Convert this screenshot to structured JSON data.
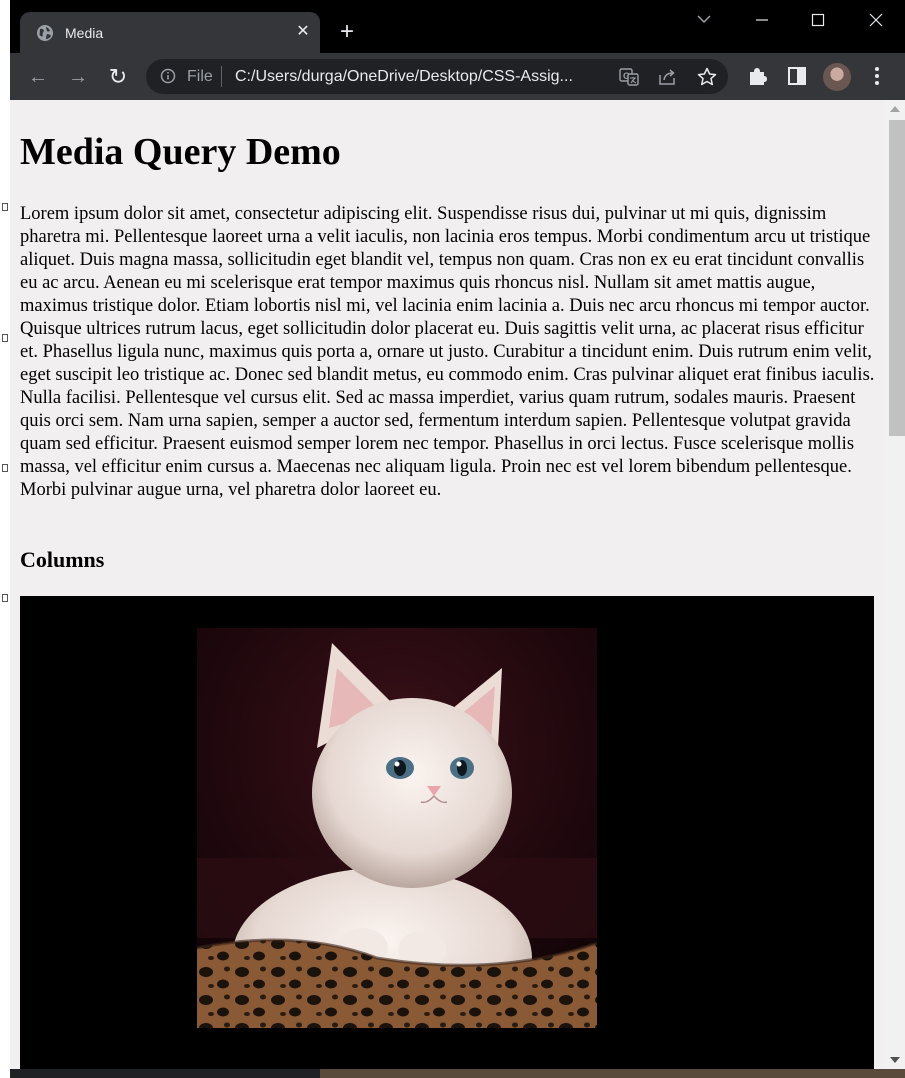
{
  "browser": {
    "tab": {
      "title": "Media",
      "close_glyph": "✕",
      "icon": "globe-icon"
    },
    "new_tab_glyph": "+",
    "window_controls": {
      "tab_search_glyph": "⌄",
      "minimize_glyph": "—",
      "maximize_glyph": "☐",
      "close_glyph": "✕"
    },
    "nav": {
      "back_glyph": "←",
      "forward_glyph": "→",
      "reload_glyph": "↻"
    },
    "omnibox": {
      "scheme": "File",
      "url": "C:/Users/durga/OneDrive/Desktop/CSS-Assig..."
    },
    "colors": {
      "frame": "#000000",
      "toolbar": "#35363a",
      "omnibox": "#202124",
      "page_background": "#f1efef"
    }
  },
  "page": {
    "heading": "Media Query Demo",
    "paragraph": "Lorem ipsum dolor sit amet, consectetur adipiscing elit. Suspendisse risus dui, pulvinar ut mi quis, dignissim pharetra mi. Pellentesque laoreet urna a velit iaculis, non lacinia eros tempus. Morbi condimentum arcu ut tristique aliquet. Duis magna massa, sollicitudin eget blandit vel, tempus non quam. Cras non ex eu erat tincidunt convallis eu ac arcu. Aenean eu mi scelerisque erat tempor maximus quis rhoncus nisl. Nullam sit amet mattis augue, maximus tristique dolor. Etiam lobortis nisl mi, vel lacinia enim lacinia a. Duis nec arcu rhoncus mi tempor auctor. Quisque ultrices rutrum lacus, eget sollicitudin dolor placerat eu. Duis sagittis velit urna, ac placerat risus efficitur et. Phasellus ligula nunc, maximus quis porta a, ornare ut justo. Curabitur a tincidunt enim. Duis rutrum enim velit, eget suscipit leo tristique ac. Donec sed blandit metus, eu commodo enim. Cras pulvinar aliquet erat finibus iaculis. Nulla facilisi. Pellentesque vel cursus elit. Sed ac massa imperdiet, varius quam rutrum, sodales mauris. Praesent quis orci sem. Nam urna sapien, semper a auctor sed, fermentum interdum sapien. Pellentesque volutpat gravida quam sed efficitur. Praesent euismod semper lorem nec tempor. Phasellus in orci lectus. Fusce scelerisque mollis massa, vel efficitur enim cursus a. Maecenas nec aliquam ligula. Proin nec est vel lorem bibendum pellentesque. Morbi pulvinar augue urna, vel pharetra dolor laoreet eu.",
    "subheading": "Columns",
    "media_box_color": "#000000"
  }
}
